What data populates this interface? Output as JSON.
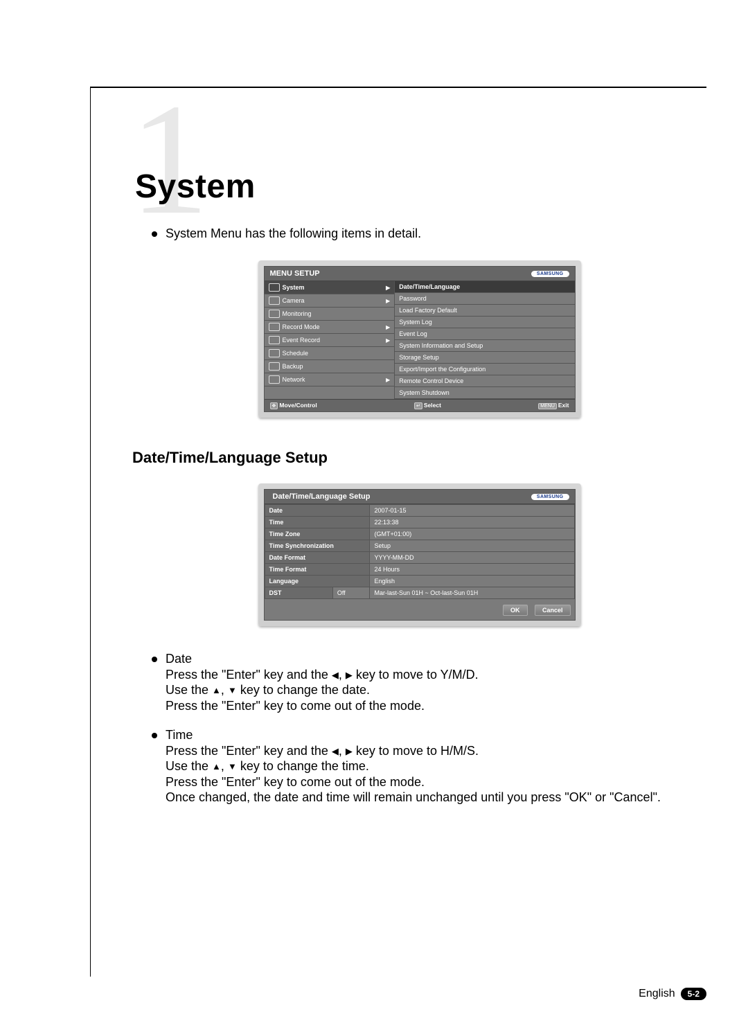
{
  "chapter": {
    "number": "1",
    "title": "System"
  },
  "intro": "System Menu has the following items in detail.",
  "menu_setup": {
    "title": "MENU SETUP",
    "brand": "SAMSUNG",
    "left": [
      {
        "label": "System",
        "expandable": true,
        "hl": true
      },
      {
        "label": "Camera",
        "expandable": true
      },
      {
        "label": "Monitoring",
        "expandable": false
      },
      {
        "label": "Record Mode",
        "expandable": true
      },
      {
        "label": "Event Record",
        "expandable": true
      },
      {
        "label": "Schedule",
        "expandable": false
      },
      {
        "label": "Backup",
        "expandable": false
      },
      {
        "label": "Network",
        "expandable": true
      }
    ],
    "right": [
      {
        "label": "Date/Time/Language",
        "hl": true
      },
      {
        "label": "Password"
      },
      {
        "label": "Load Factory Default"
      },
      {
        "label": "System Log"
      },
      {
        "label": "Event Log"
      },
      {
        "label": "System Information and Setup"
      },
      {
        "label": "Storage Setup"
      },
      {
        "label": "Export/Import the Configuration"
      },
      {
        "label": "Remote Control Device"
      },
      {
        "label": "System Shutdown"
      }
    ],
    "footer": {
      "move": "Move/Control",
      "select": "Select",
      "exit": "Exit"
    }
  },
  "section_heading": "Date/Time/Language Setup",
  "dtl_setup": {
    "title": "Date/Time/Language Setup",
    "brand": "SAMSUNG",
    "rows": [
      {
        "label": "Date",
        "value": "2007-01-15"
      },
      {
        "label": "Time",
        "value": "22:13:38"
      },
      {
        "label": "Time Zone",
        "value": "(GMT+01:00)"
      },
      {
        "label": "Time Synchronization",
        "value": "Setup"
      },
      {
        "label": "Date Format",
        "value": "YYYY-MM-DD"
      },
      {
        "label": "Time Format",
        "value": "24 Hours"
      },
      {
        "label": "Language",
        "value": "English"
      }
    ],
    "dst_row": {
      "label": "DST",
      "toggle": "Off",
      "value": "Mar-last-Sun 01H ~ Oct-last-Sun 01H"
    },
    "buttons": {
      "ok": "OK",
      "cancel": "Cancel"
    }
  },
  "descriptions": [
    {
      "title": "Date",
      "lines": [
        "Press the \"Enter\" key and the ◀, ▶ key to move to Y/M/D.",
        "Use the ▲, ▼ key to change the date.",
        "Press the \"Enter\" key to come out of the mode."
      ]
    },
    {
      "title": "Time",
      "lines": [
        "Press the \"Enter\" key and the ◀, ▶ key to move to H/M/S.",
        "Use the ▲, ▼ key to change the time.",
        "Press the \"Enter\" key to come out of the mode.",
        "Once changed, the date and time will remain unchanged until you press \"OK\" or \"Cancel\"."
      ]
    }
  ],
  "footer": {
    "lang": "English",
    "page": "5-2"
  }
}
